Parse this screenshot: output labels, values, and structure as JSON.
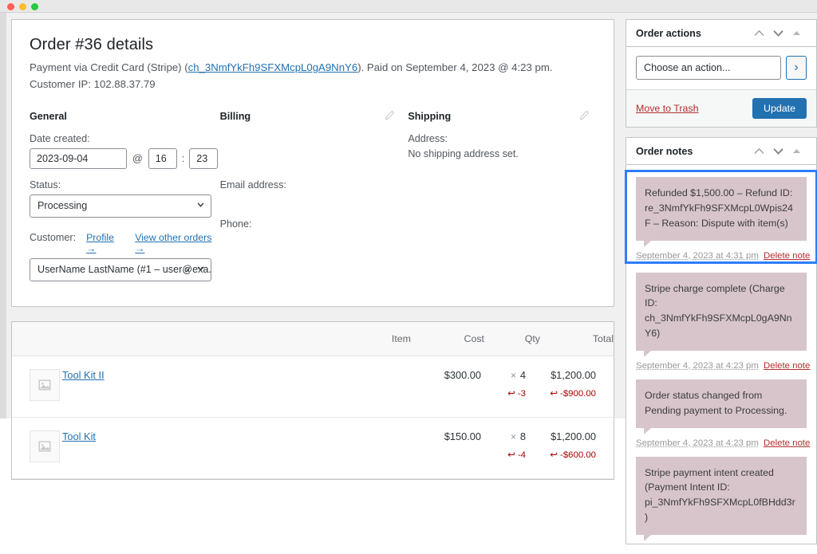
{
  "window": {
    "traffic_lights": [
      "close",
      "minimize",
      "zoom"
    ]
  },
  "order": {
    "title": "Order #36 details",
    "payment_prefix": "Payment via Credit Card (Stripe) (",
    "charge_id_link": "ch_3NmfYkFh9SFXMcpL0gA9NnY6",
    "payment_suffix": "). Paid on September 4, 2023 @ 4:23 pm.",
    "customer_ip": "Customer IP: 102.88.37.79"
  },
  "general": {
    "heading": "General",
    "date_label": "Date created:",
    "date_value": "2023-09-04",
    "at_symbol": "@",
    "hour_value": "16",
    "colon": ":",
    "minute_value": "23",
    "status_label": "Status:",
    "status_value": "Processing",
    "customer_label": "Customer:",
    "profile_link": "Profile →",
    "other_orders_link": "View other orders →",
    "customer_value": "UserName LastName (#1 – user@exa...",
    "clear_glyph": "×"
  },
  "billing": {
    "heading": "Billing",
    "email_label": "Email address:",
    "phone_label": "Phone:",
    "edit_icon": "pencil-icon"
  },
  "shipping": {
    "heading": "Shipping",
    "address_label": "Address:",
    "address_value": "No shipping address set.",
    "edit_icon": "pencil-icon"
  },
  "items": {
    "columns": [
      "Item",
      "Cost",
      "Qty",
      "Total"
    ],
    "rows": [
      {
        "name": "Tool Kit II",
        "cost": "$300.00",
        "qty_mult": "×",
        "qty": "4",
        "total": "$1,200.00",
        "refund_qty": "-3",
        "refund_total": "-$900.00",
        "refund_icon": "↩"
      },
      {
        "name": "Tool Kit",
        "cost": "$150.00",
        "qty_mult": "×",
        "qty": "8",
        "total": "$1,200.00",
        "refund_qty": "-4",
        "refund_total": "-$600.00",
        "refund_icon": "↩"
      }
    ]
  },
  "order_actions": {
    "title": "Order actions",
    "select_value": "Choose an action...",
    "go_label": "›",
    "trash_label": "Move to Trash",
    "update_label": "Update"
  },
  "order_notes": {
    "title": "Order notes",
    "notes": [
      {
        "text": "Refunded $1,500.00 – Refund ID: re_3NmfYkFh9SFXMcpL0Wpis24F – Reason: Dispute with item(s)",
        "timestamp": "September 4, 2023 at 4:31 pm",
        "delete_label": "Delete note",
        "highlighted": true
      },
      {
        "text": "Stripe charge complete (Charge ID: ch_3NmfYkFh9SFXMcpL0gA9NnY6)",
        "timestamp": "September 4, 2023 at 4:23 pm",
        "delete_label": "Delete note",
        "highlighted": false
      },
      {
        "text": "Order status changed from Pending payment to Processing.",
        "timestamp": "September 4, 2023 at 4:23 pm",
        "delete_label": "Delete note",
        "highlighted": false
      },
      {
        "text": "Stripe payment intent created (Payment Intent ID: pi_3NmfYkFh9SFXMcpL0fBHdd3r)",
        "timestamp": "",
        "delete_label": "",
        "highlighted": false
      }
    ]
  },
  "colors": {
    "accent_blue": "#2271b1",
    "highlight_blue": "#2e7dfb",
    "note_bg": "#d7c5cb",
    "danger_red": "#b32d2e",
    "refund_red": "#aa0000",
    "page_bg": "#f0f0f1"
  }
}
